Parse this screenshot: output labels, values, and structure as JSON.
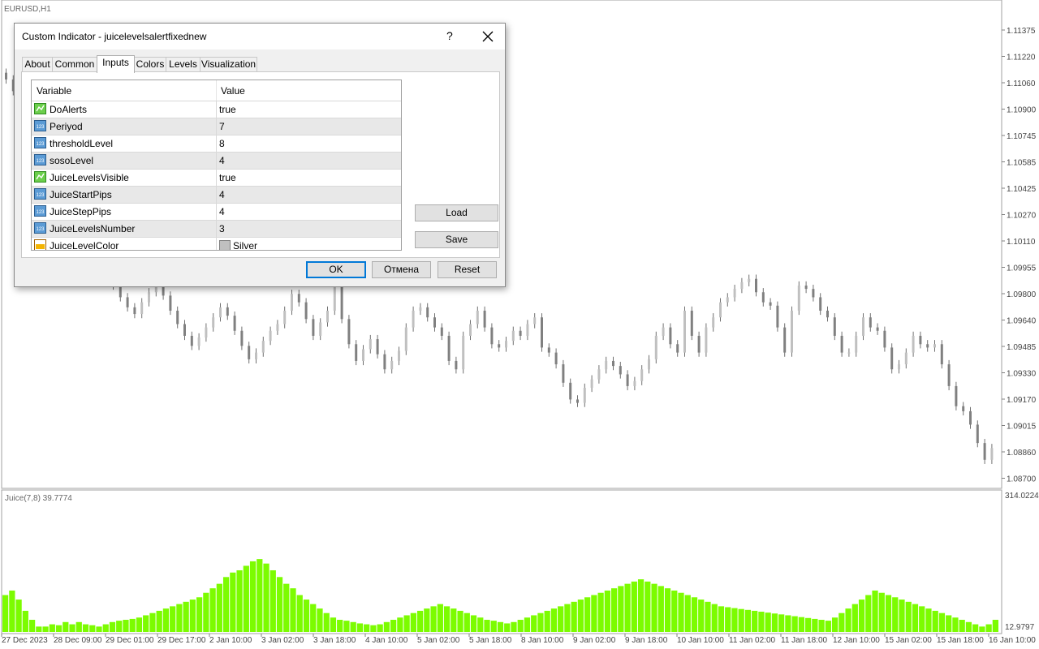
{
  "chart": {
    "symbol_label": "EURUSD,H1",
    "price_ticks": [
      "1.11375",
      "1.11220",
      "1.11060",
      "1.10900",
      "1.10745",
      "1.10585",
      "1.10425",
      "1.10270",
      "1.10110",
      "1.09955",
      "1.09800",
      "1.09640",
      "1.09485",
      "1.09330",
      "1.09170",
      "1.09015",
      "1.08860",
      "1.08700"
    ],
    "indicator_label": "Juice(7,8) 39.7774",
    "indicator_max": "314.0224",
    "indicator_min": "12.9797",
    "time_ticks": [
      "27 Dec 2023",
      "28 Dec 09:00",
      "29 Dec 01:00",
      "29 Dec 17:00",
      "2 Jan 10:00",
      "3 Jan 02:00",
      "3 Jan 18:00",
      "4 Jan 10:00",
      "5 Jan 02:00",
      "5 Jan 18:00",
      "8 Jan 10:00",
      "9 Jan 02:00",
      "9 Jan 18:00",
      "10 Jan 10:00",
      "11 Jan 02:00",
      "11 Jan 18:00",
      "12 Jan 10:00",
      "15 Jan 02:00",
      "15 Jan 18:00",
      "16 Jan 10:00"
    ],
    "colors": {
      "bull": "#c0c0c0",
      "bear": "#808080",
      "histogram": "#7cfc00",
      "grid": "#ffffff"
    }
  },
  "chart_data": [
    {
      "type": "candlestick",
      "title": "EURUSD,H1",
      "ylim": [
        1.087,
        1.1145
      ],
      "close": [
        1.1108,
        1.1101,
        1.1091,
        1.108,
        1.1072,
        1.1065,
        1.107,
        1.1061,
        1.1055,
        1.1048,
        1.1042,
        1.103,
        1.1018,
        1.1006,
        1.0995,
        1.0985,
        1.0978,
        1.0972,
        1.0968,
        1.0975,
        1.0981,
        1.0986,
        1.0979,
        1.097,
        1.0962,
        1.0955,
        1.0949,
        1.0954,
        1.096,
        1.0966,
        1.0972,
        1.0967,
        1.0958,
        1.0949,
        1.0941,
        1.0945,
        1.0952,
        1.0958,
        1.0962,
        1.097,
        1.098,
        1.0975,
        1.0965,
        1.0955,
        1.0963,
        1.097,
        1.0985,
        1.0965,
        1.095,
        1.094,
        1.0947,
        1.0953,
        1.0944,
        1.0935,
        1.094,
        1.0946,
        1.096,
        1.097,
        1.0972,
        1.0966,
        1.096,
        1.0955,
        1.094,
        1.0935,
        1.0955,
        1.0962,
        1.097,
        1.096,
        1.095,
        1.0948,
        1.0952,
        1.0958,
        1.0955,
        1.0962,
        1.0966,
        1.0948,
        1.0945,
        1.0938,
        1.0927,
        1.0917,
        1.0915,
        1.0924,
        1.0929,
        1.0935,
        1.094,
        1.0937,
        1.0932,
        1.0925,
        1.0928,
        1.0935,
        1.0941,
        1.0955,
        1.096,
        1.095,
        1.0945,
        1.097,
        1.0955,
        1.0945,
        1.096,
        1.0966,
        1.0975,
        1.0978,
        1.0983,
        1.0987,
        1.0989,
        1.0981,
        1.0975,
        1.0973,
        1.096,
        1.0945,
        1.097,
        1.0985,
        1.0983,
        1.0978,
        1.097,
        1.0966,
        1.0955,
        1.0945,
        1.0945,
        1.0955,
        1.0966,
        1.096,
        1.0958,
        1.0948,
        1.0935,
        1.0938,
        1.0945,
        1.0955,
        1.095,
        1.0948,
        1.095,
        1.0938,
        1.0925,
        1.0913,
        1.091,
        1.0902,
        1.0891,
        1.0881,
        1.0888
      ]
    },
    {
      "type": "bar",
      "title": "Juice(7,8) 39.7774",
      "ylim": [
        12.9797,
        314.0224
      ],
      "values": [
        95,
        105,
        85,
        60,
        40,
        25,
        25,
        30,
        28,
        35,
        30,
        35,
        30,
        28,
        25,
        30,
        35,
        38,
        40,
        42,
        45,
        50,
        55,
        60,
        65,
        70,
        75,
        80,
        85,
        90,
        100,
        110,
        120,
        135,
        145,
        150,
        160,
        170,
        175,
        165,
        150,
        135,
        120,
        110,
        95,
        85,
        75,
        65,
        55,
        45,
        40,
        38,
        35,
        32,
        30,
        28,
        30,
        35,
        40,
        45,
        50,
        55,
        60,
        65,
        70,
        75,
        70,
        65,
        60,
        55,
        50,
        45,
        40,
        38,
        35,
        32,
        35,
        40,
        45,
        50,
        55,
        60,
        65,
        70,
        75,
        80,
        85,
        90,
        95,
        100,
        105,
        110,
        115,
        120,
        125,
        130,
        125,
        120,
        115,
        110,
        105,
        100,
        95,
        90,
        85,
        80,
        75,
        70,
        68,
        66,
        64,
        62,
        60,
        58,
        56,
        54,
        52,
        50,
        48,
        46,
        44,
        42,
        40,
        38,
        45,
        55,
        65,
        75,
        85,
        95,
        105,
        100,
        95,
        90,
        85,
        80,
        75,
        70,
        65,
        60,
        55,
        50,
        45,
        40,
        35,
        30,
        25,
        30,
        40
      ]
    }
  ],
  "dialog": {
    "title": "Custom Indicator - juicelevelsalertfixednew",
    "help_label": "?",
    "tabs": [
      "About",
      "Common",
      "Inputs",
      "Colors",
      "Levels",
      "Visualization"
    ],
    "active_tab": "Inputs",
    "grid_headers": {
      "variable": "Variable",
      "value": "Value"
    },
    "params": [
      {
        "name": "DoAlerts",
        "value": "true",
        "icon": "bool-icon"
      },
      {
        "name": "Periyod",
        "value": "7",
        "icon": "int-icon"
      },
      {
        "name": "thresholdLevel",
        "value": "8",
        "icon": "int-icon"
      },
      {
        "name": "sosoLevel",
        "value": "4",
        "icon": "int-icon"
      },
      {
        "name": "JuiceLevelsVisible",
        "value": "true",
        "icon": "bool-icon"
      },
      {
        "name": "JuiceStartPips",
        "value": "4",
        "icon": "int-icon"
      },
      {
        "name": "JuiceStepPips",
        "value": "4",
        "icon": "int-icon"
      },
      {
        "name": "JuiceLevelsNumber",
        "value": "3",
        "icon": "int-icon"
      },
      {
        "name": "JuiceLevelColor",
        "value": "Silver",
        "icon": "color-icon"
      }
    ],
    "load_label": "Load",
    "save_label": "Save",
    "ok_label": "OK",
    "cancel_label": "Отмена",
    "reset_label": "Reset"
  }
}
